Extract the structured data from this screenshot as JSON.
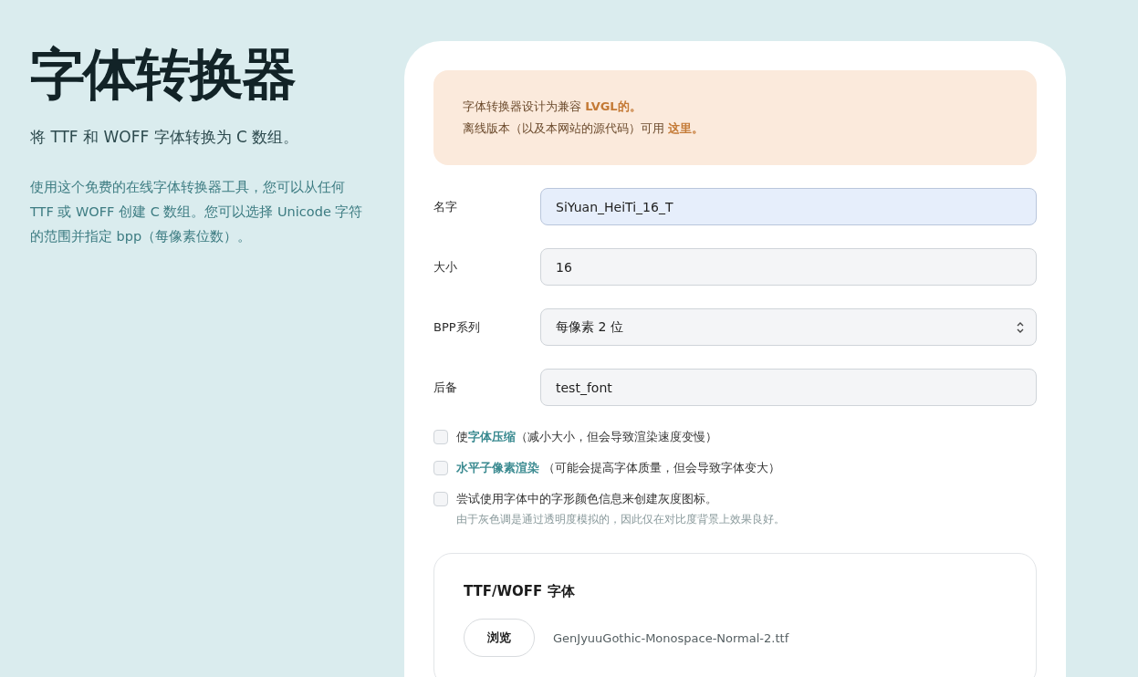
{
  "intro": {
    "title": "字体转换器",
    "subtitle": "将 TTF 和 WOFF 字体转换为 C 数组。",
    "description": "使用这个免费的在线字体转换器工具，您可以从任何 TTF 或 WOFF 创建 C 数组。您可以选择 Unicode 字符的范围并指定 bpp（每像素位数）。"
  },
  "notice": {
    "lines": [
      "字体转换器设计为兼容 **LVGL的。**",
      "离线版本（以及本网站的源代码）可用 **这里。**"
    ]
  },
  "fields": [
    {
      "label": "名字",
      "kind": "text",
      "value": "SiYuan_HeiTi_16_T",
      "focused": true
    },
    {
      "label": "大小",
      "kind": "text",
      "value": "16",
      "focused": false
    },
    {
      "label": "BPP系列",
      "kind": "select",
      "value": "每像素 2 位",
      "focused": false
    },
    {
      "label": "后备",
      "kind": "text",
      "value": "test_font",
      "focused": false
    }
  ],
  "options": [
    {
      "label": "使**字体压缩**（减小大小，但会导致渲染速度变慢）",
      "checked": false
    },
    {
      "label": "**水平子像素渲染** （可能会提高字体质量，但会导致字体变大）",
      "checked": false
    },
    {
      "label": "尝试使用字体中的字形颜色信息来创建灰度图标。",
      "hint": "由于灰色调是通过透明度模拟的，因此仅在对比度背景上效果良好。",
      "checked": false
    }
  ],
  "font_section": {
    "title": "TTF/WOFF 字体",
    "button": "浏览",
    "file_name": "GenJyuuGothic-Monospace-Normal-2.ttf"
  }
}
